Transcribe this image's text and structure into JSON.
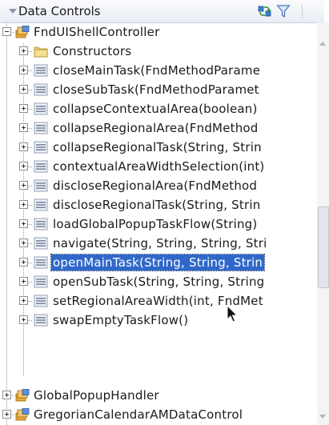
{
  "panel": {
    "title": "Data Controls",
    "refresh_icon": "refresh-icon",
    "filter_icon": "filter-icon"
  },
  "tree": {
    "root": {
      "label": "FndUIShellController",
      "icon": "data-control-icon",
      "expanded": true
    },
    "children": [
      {
        "label": "Constructors",
        "icon": "folder-icon"
      },
      {
        "label": "closeMainTask(FndMethodParame",
        "icon": "method-icon"
      },
      {
        "label": "closeSubTask(FndMethodParamet",
        "icon": "method-icon"
      },
      {
        "label": "collapseContextualArea(boolean)",
        "icon": "method-icon"
      },
      {
        "label": "collapseRegionalArea(FndMethod",
        "icon": "method-icon"
      },
      {
        "label": "collapseRegionalTask(String, Strin",
        "icon": "method-icon"
      },
      {
        "label": "contextualAreaWidthSelection(int)",
        "icon": "method-icon"
      },
      {
        "label": "discloseRegionalArea(FndMethod",
        "icon": "method-icon"
      },
      {
        "label": "discloseRegionalTask(String, Strin",
        "icon": "method-icon"
      },
      {
        "label": "loadGlobalPopupTaskFlow(String)",
        "icon": "method-icon"
      },
      {
        "label": "navigate(String, String, String, Stri",
        "icon": "method-icon"
      },
      {
        "label": "openMainTask(String, String, Strin",
        "icon": "method-icon",
        "selected": true
      },
      {
        "label": "openSubTask(String, String, String",
        "icon": "method-icon"
      },
      {
        "label": "setRegionalAreaWidth(int, FndMet",
        "icon": "method-icon"
      },
      {
        "label": "swapEmptyTaskFlow()",
        "icon": "method-icon"
      }
    ],
    "siblings": [
      {
        "label": "GlobalPopupHandler",
        "icon": "data-control-icon"
      },
      {
        "label": "GregorianCalendarAMDataControl",
        "icon": "data-control-icon"
      }
    ]
  },
  "colors": {
    "selection": "#3068c9",
    "header_bg": "#e8edf4"
  }
}
